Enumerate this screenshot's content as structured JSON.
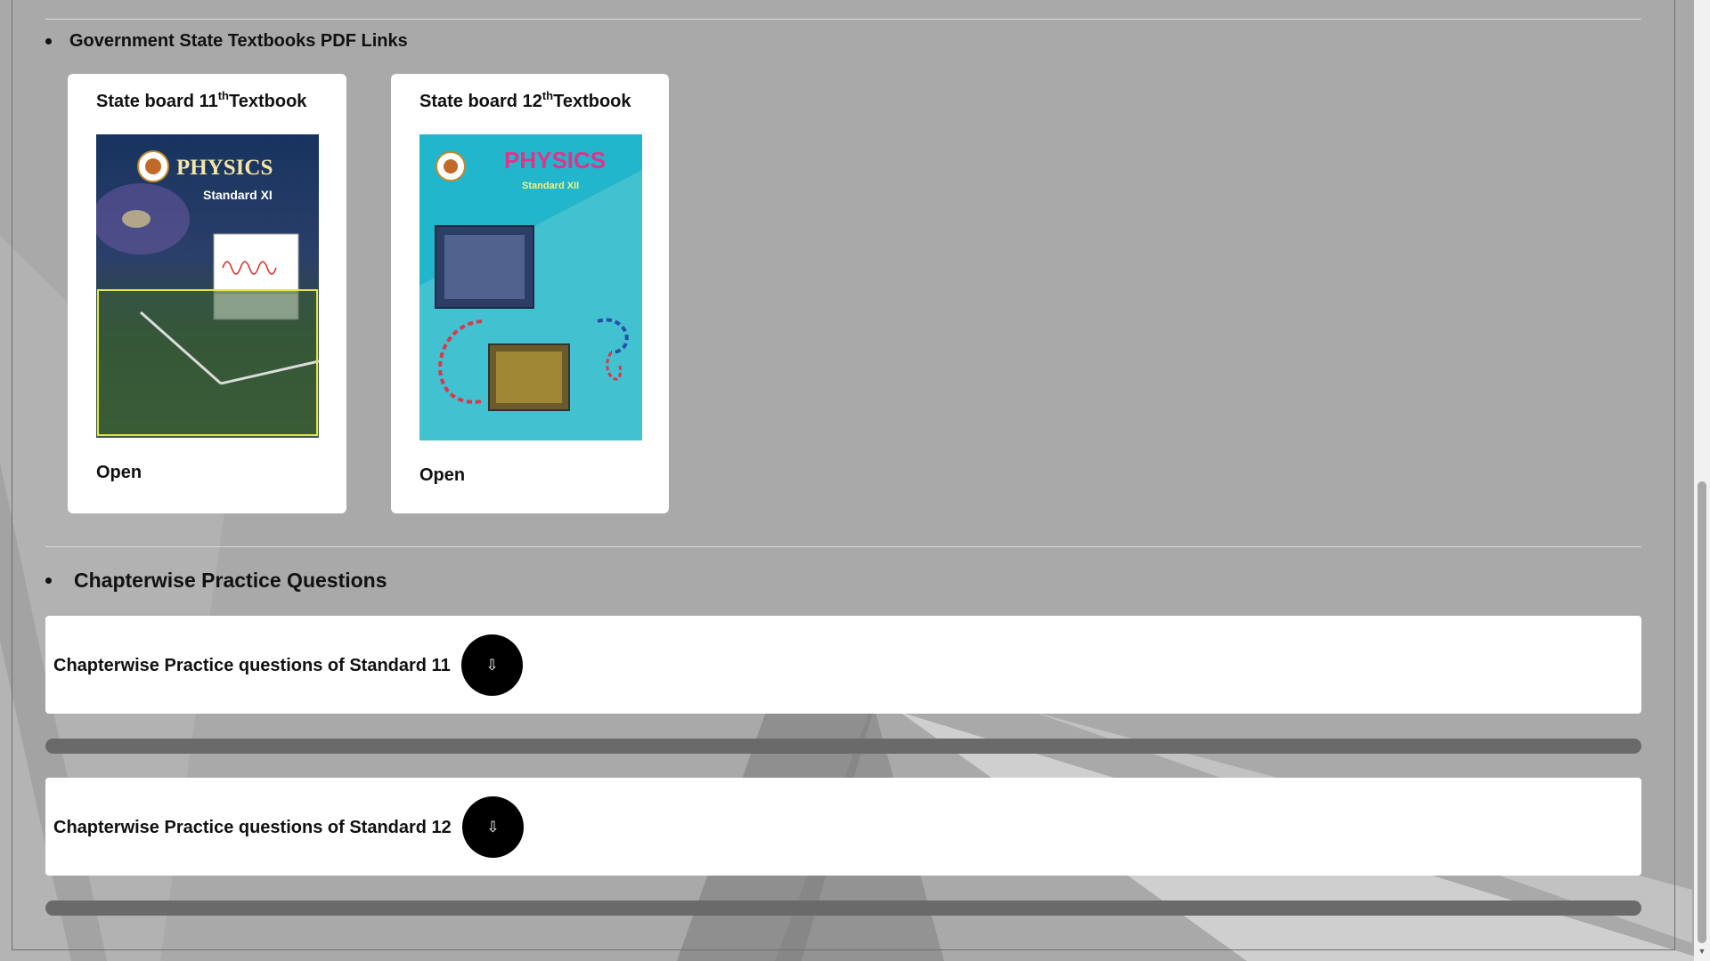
{
  "textbooks_section": {
    "title": "Government State Textbooks PDF Links",
    "cards": [
      {
        "title_prefix": "State board 11",
        "title_sup": "th",
        "title_suffix": "Textbook",
        "cover": {
          "heading": "PHYSICS",
          "subheading": "Standard XI",
          "bg_top": "#1a3f6e",
          "bg_bottom": "#2c4a2a",
          "heading_color": "#f5e6a8"
        },
        "open_label": "Open"
      },
      {
        "title_prefix": "State board 12",
        "title_sup": "th",
        "title_suffix": "Textbook",
        "cover": {
          "heading": "PHYSICS",
          "subheading": "Standard XII",
          "bg_color": "#22b6cc",
          "heading_color": "#e0338a",
          "subheading_color": "#f2f27a"
        },
        "open_label": "Open"
      }
    ]
  },
  "practice_section": {
    "title": "Chapterwise Practice Questions",
    "items": [
      {
        "label": "Chapterwise Practice questions of Standard 11",
        "icon": "download-arrow-icon",
        "glyph": "⇩"
      },
      {
        "label": "Chapterwise Practice questions of Standard 12",
        "icon": "download-arrow-icon",
        "glyph": "⇩"
      }
    ]
  },
  "colors": {
    "page_bg": "#a9a9a9",
    "card_bg": "#ffffff",
    "button_bg": "#000000",
    "bar_color": "#6a6a6a"
  }
}
